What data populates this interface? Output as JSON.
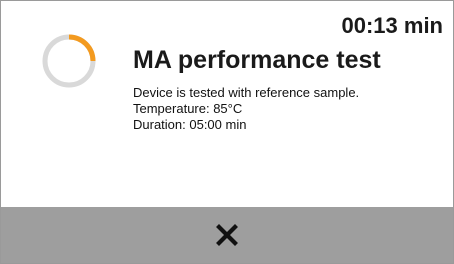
{
  "header": {
    "timer": "00:13 min"
  },
  "test": {
    "title": "MA performance test",
    "description": "Device is tested with reference sample.",
    "temperature": "Temperature: 85°C",
    "duration": "Duration: 05:00 min"
  },
  "progress": {
    "fraction": 0.25,
    "track_color": "#d9d9d9",
    "fill_color": "#f39a1f"
  },
  "footer": {
    "close_icon": "close-icon",
    "background_color": "#9e9e9e"
  }
}
